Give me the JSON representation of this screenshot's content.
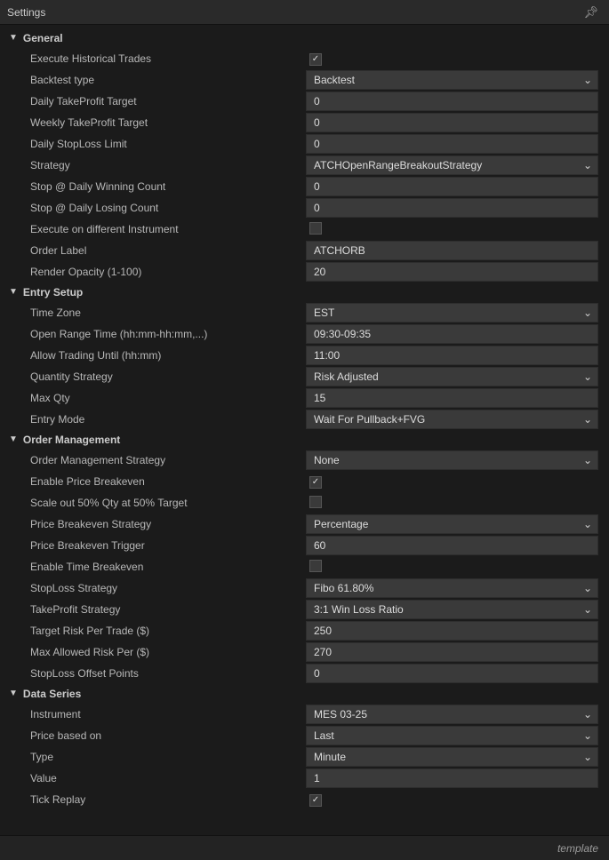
{
  "window": {
    "title": "Settings",
    "template_link": "template"
  },
  "sections": {
    "general": {
      "title": "General",
      "rows": {
        "exec_hist": {
          "label": "Execute Historical Trades",
          "checked": true
        },
        "backtest_type": {
          "label": "Backtest type",
          "value": "Backtest"
        },
        "daily_tp": {
          "label": "Daily TakeProfit Target",
          "value": "0"
        },
        "weekly_tp": {
          "label": "Weekly TakeProfit Target",
          "value": "0"
        },
        "daily_sl": {
          "label": "Daily StopLoss Limit",
          "value": "0"
        },
        "strategy": {
          "label": "Strategy",
          "value": "ATCHOpenRangeBreakoutStrategy"
        },
        "stop_win": {
          "label": "Stop @ Daily Winning Count",
          "value": "0"
        },
        "stop_lose": {
          "label": "Stop @ Daily Losing Count",
          "value": "0"
        },
        "exec_diff": {
          "label": "Execute on different Instrument",
          "checked": false
        },
        "order_label": {
          "label": "Order Label",
          "value": "ATCHORB"
        },
        "opacity": {
          "label": "Render Opacity (1-100)",
          "value": "20"
        }
      }
    },
    "entry": {
      "title": "Entry Setup",
      "rows": {
        "tz": {
          "label": "Time Zone",
          "value": "EST"
        },
        "ort": {
          "label": "Open Range Time (hh:mm-hh:mm,...)",
          "value": "09:30-09:35"
        },
        "until": {
          "label": "Allow Trading Until (hh:mm)",
          "value": "11:00"
        },
        "qty_strat": {
          "label": "Quantity Strategy",
          "value": "Risk Adjusted"
        },
        "max_qty": {
          "label": "Max Qty",
          "value": "15"
        },
        "entry_mode": {
          "label": "Entry Mode",
          "value": "Wait For Pullback+FVG"
        }
      }
    },
    "order": {
      "title": "Order Management",
      "rows": {
        "om_strat": {
          "label": "Order Management Strategy",
          "value": "None"
        },
        "en_pb": {
          "label": "Enable Price Breakeven",
          "checked": true
        },
        "scale": {
          "label": "Scale out 50% Qty at 50% Target",
          "checked": false
        },
        "pb_strat": {
          "label": "Price Breakeven Strategy",
          "value": "Percentage"
        },
        "pb_trig": {
          "label": "Price Breakeven Trigger",
          "value": "60"
        },
        "en_tb": {
          "label": "Enable Time Breakeven",
          "checked": false
        },
        "sl_strat": {
          "label": "StopLoss Strategy",
          "value": "Fibo 61.80%"
        },
        "tp_strat": {
          "label": "TakeProfit Strategy",
          "value": "3:1 Win Loss Ratio"
        },
        "tgt_risk": {
          "label": "Target Risk Per Trade ($)",
          "value": "250"
        },
        "max_risk": {
          "label": "Max Allowed Risk Per ($)",
          "value": "270"
        },
        "sl_off": {
          "label": "StopLoss Offset Points",
          "value": "0"
        }
      }
    },
    "data": {
      "title": "Data Series",
      "rows": {
        "instrument": {
          "label": "Instrument",
          "value": "MES 03-25"
        },
        "price_based": {
          "label": "Price based on",
          "value": "Last"
        },
        "type": {
          "label": "Type",
          "value": "Minute"
        },
        "value": {
          "label": "Value",
          "value": "1"
        },
        "tick_replay": {
          "label": "Tick Replay",
          "checked": true
        }
      }
    }
  }
}
